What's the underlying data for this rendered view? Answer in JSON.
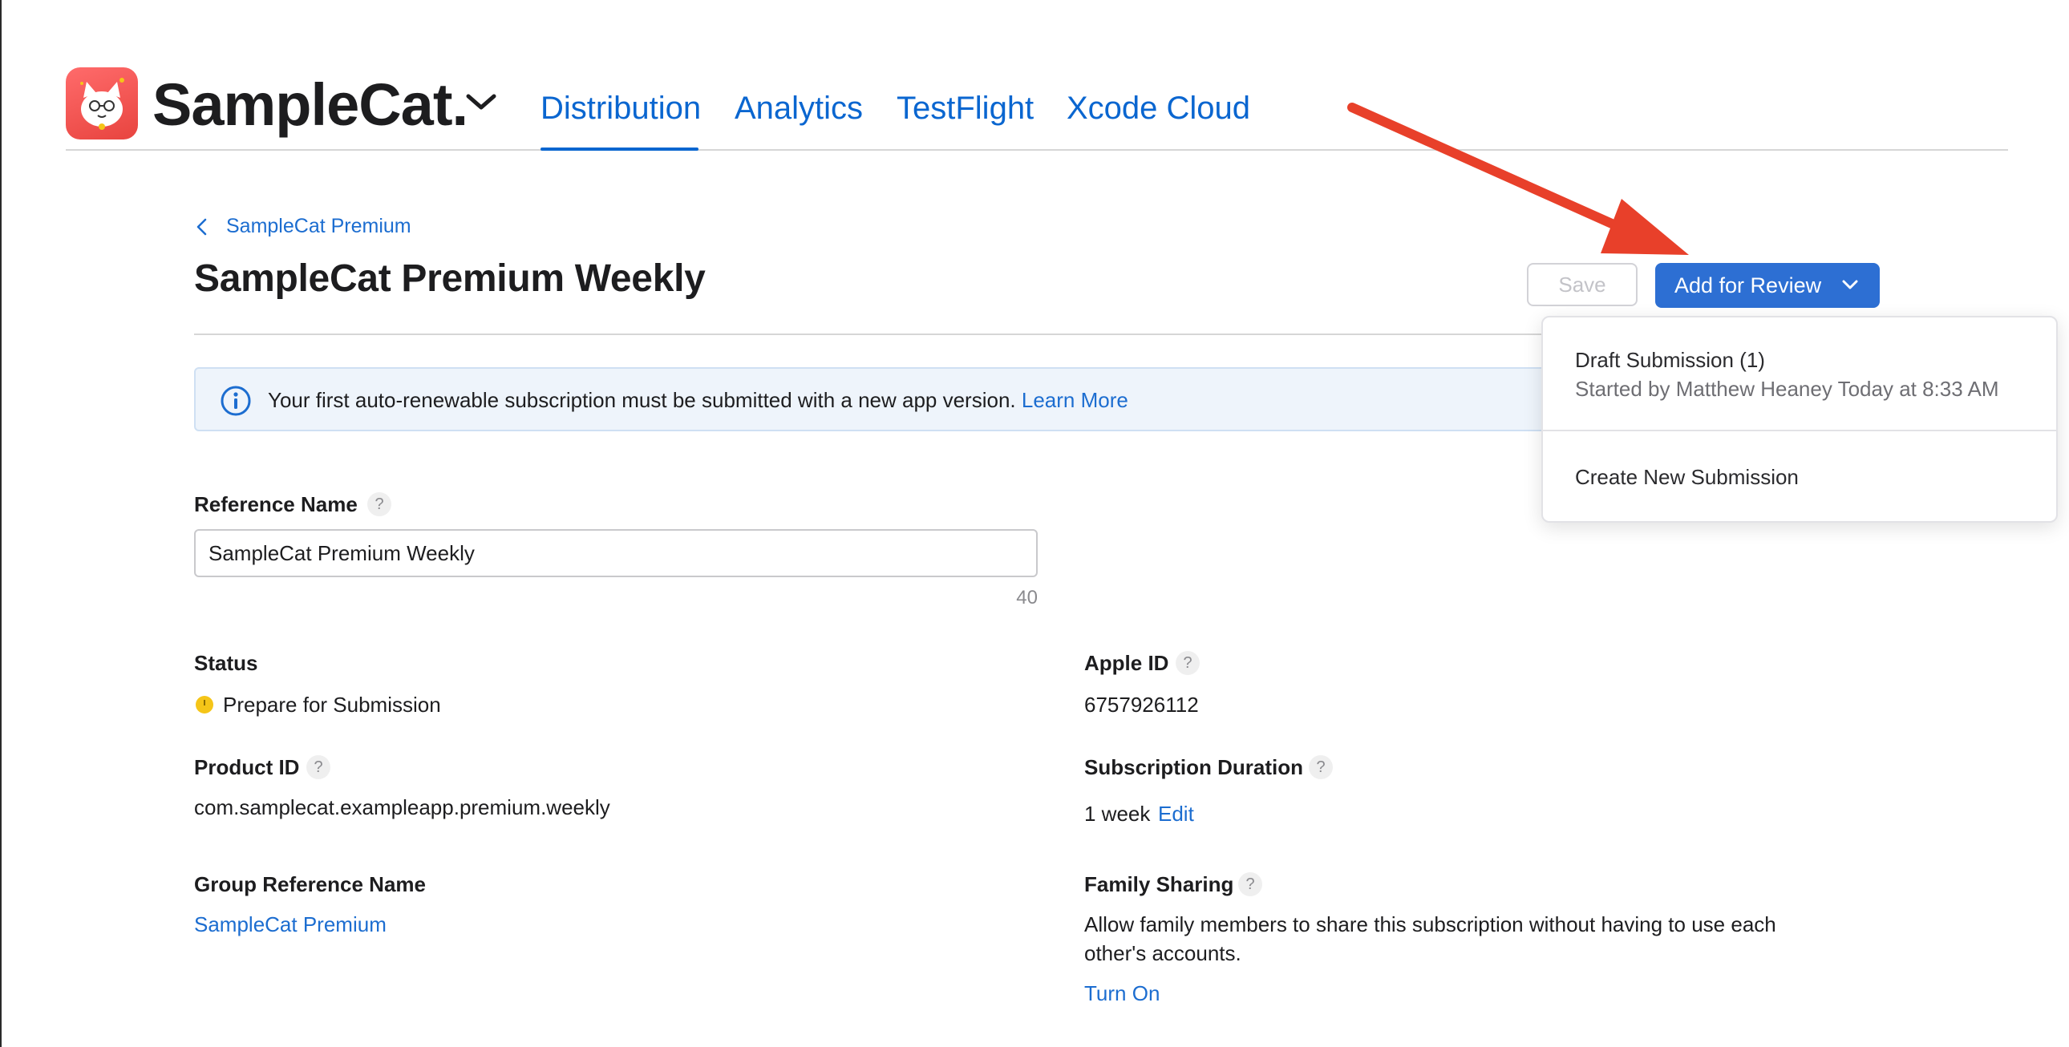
{
  "app": {
    "name": "SampleCat.",
    "tabs": [
      {
        "label": "Distribution",
        "active": true
      },
      {
        "label": "Analytics",
        "active": false
      },
      {
        "label": "TestFlight",
        "active": false
      },
      {
        "label": "Xcode Cloud",
        "active": false
      }
    ]
  },
  "breadcrumb": {
    "label": "SampleCat Premium"
  },
  "page": {
    "title": "SampleCat Premium Weekly"
  },
  "toolbar": {
    "save_label": "Save",
    "review_label": "Add for Review"
  },
  "dropdown": {
    "draft_title": "Draft Submission (1)",
    "draft_subtitle": "Started by Matthew Heaney Today at 8:33 AM",
    "create_label": "Create New Submission"
  },
  "banner": {
    "text": "Your first auto-renewable subscription must be submitted with a new app version.",
    "link": "Learn More"
  },
  "form": {
    "reference_name": {
      "label": "Reference Name",
      "help": "?",
      "value": "SampleCat Premium Weekly",
      "char_count": "40"
    },
    "status": {
      "label": "Status",
      "value": "Prepare for Submission",
      "status_color": "#f5c518"
    },
    "apple_id": {
      "label": "Apple ID",
      "help": "?",
      "value": "6757926112"
    },
    "product_id": {
      "label": "Product ID",
      "help": "?",
      "value": "com.samplecat.exampleapp.premium.weekly"
    },
    "subscription_duration": {
      "label": "Subscription Duration",
      "help": "?",
      "value": "1 week",
      "edit_label": "Edit"
    },
    "group_reference_name": {
      "label": "Group Reference Name",
      "value": "SampleCat Premium"
    },
    "family_sharing": {
      "label": "Family Sharing",
      "help": "?",
      "description_line1": "Allow family members to share this subscription without having to use each",
      "description_line2": "other's accounts.",
      "action_label": "Turn On"
    }
  },
  "colors": {
    "accent": "#0a66d0",
    "primary_button": "#2d6fd3",
    "annotation_arrow": "#e8402a",
    "banner_bg": "#eef4fb"
  },
  "icons": {
    "app_icon": "samplecat-app-icon",
    "info": "info-icon",
    "chevron_down": "chevron-down-icon",
    "chevron_left": "chevron-left-icon"
  }
}
